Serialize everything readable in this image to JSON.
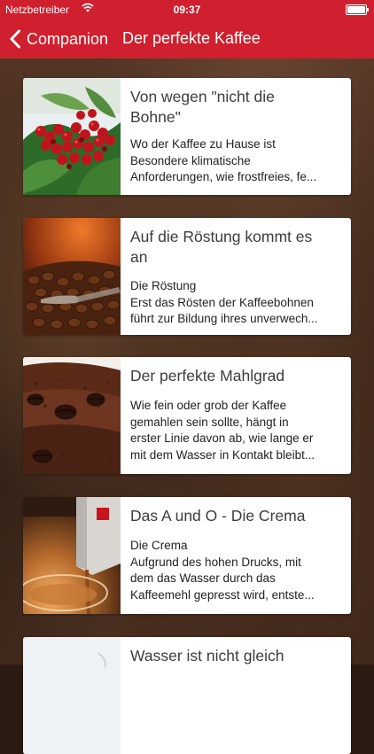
{
  "status_bar": {
    "carrier": "Netzbetreiber",
    "time": "09:37"
  },
  "nav": {
    "back_label": "Companion",
    "title": "Der perfekte Kaffee"
  },
  "articles": [
    {
      "title_lines": [
        "Von wegen \"nicht die",
        "Bohne\""
      ],
      "lines": [
        "Wo der Kaffee zu Hause ist",
        "Besondere klimatische",
        "Anforderungen, wie frostfreies, fe..."
      ],
      "image": "coffee-cherries"
    },
    {
      "title_lines": [
        "Auf die Röstung kommt es",
        "an"
      ],
      "lines": [
        "Die Röstung",
        "Erst das Rösten der Kaffeebohnen",
        "führt zur Bildung ihres unverwech..."
      ],
      "image": "roasted-beans"
    },
    {
      "title_lines": [
        "Der perfekte Mahlgrad"
      ],
      "lines": [
        "Wie fein oder grob der Kaffee",
        "gemahlen sein sollte, hängt in",
        "erster Linie davon ab, wie lange er",
        "mit dem Wasser in Kontakt bleibt..."
      ],
      "image": "ground-coffee"
    },
    {
      "title_lines": [
        "Das A und O - Die Crema"
      ],
      "lines": [
        "Die Crema",
        "Aufgrund des hohen Drucks, mit",
        "dem das Wasser durch das",
        "Kaffeemehl gepresst wird, entste..."
      ],
      "image": "espresso-crema"
    },
    {
      "title_lines": [
        "Wasser ist nicht gleich"
      ],
      "lines": [],
      "image": "water"
    }
  ],
  "colors": {
    "accent": "#d01f2e",
    "card_bg": "#ffffff",
    "title_text": "#3d3d3d"
  },
  "icons": {
    "back": "chevron-left-icon",
    "wifi": "wifi-icon",
    "battery": "battery-icon"
  }
}
